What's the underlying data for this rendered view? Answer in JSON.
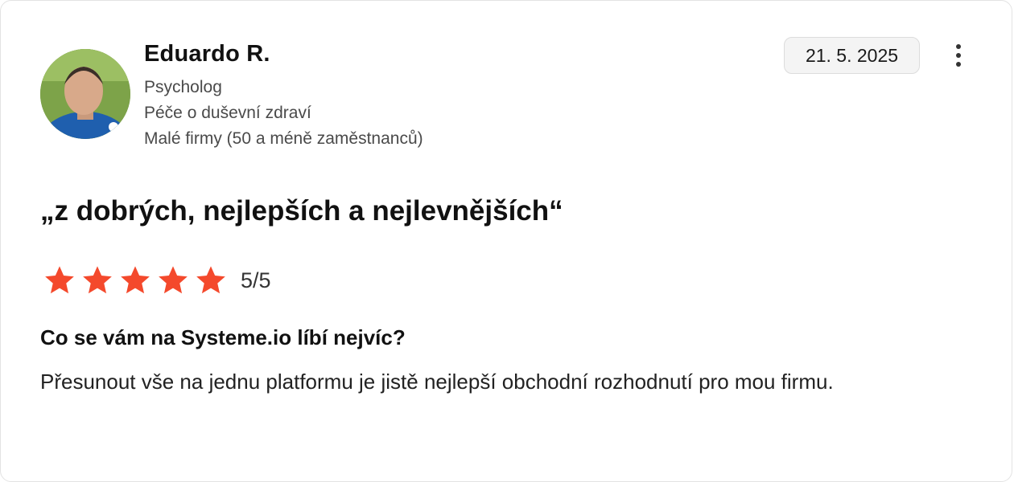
{
  "reviewer": {
    "name": "Eduardo R.",
    "role": "Psycholog",
    "industry": "Péče o duševní zdraví",
    "company_size": "Malé firmy (50 a méně zaměstnanců)"
  },
  "review": {
    "date": "21. 5. 2025",
    "title": "„z dobrých, nejlepších a nejlevnějších“",
    "rating": 5,
    "rating_max": 5,
    "rating_label": "5/5",
    "star_color": "#f4492c",
    "question": "Co se vám na Systeme.io líbí nejvíc?",
    "answer": "Přesunout vše na jednu platformu je jistě nejlepší obchodní rozhodnutí pro mou firmu."
  },
  "icons": {
    "menu": "more-vertical-icon",
    "star": "star-icon"
  }
}
